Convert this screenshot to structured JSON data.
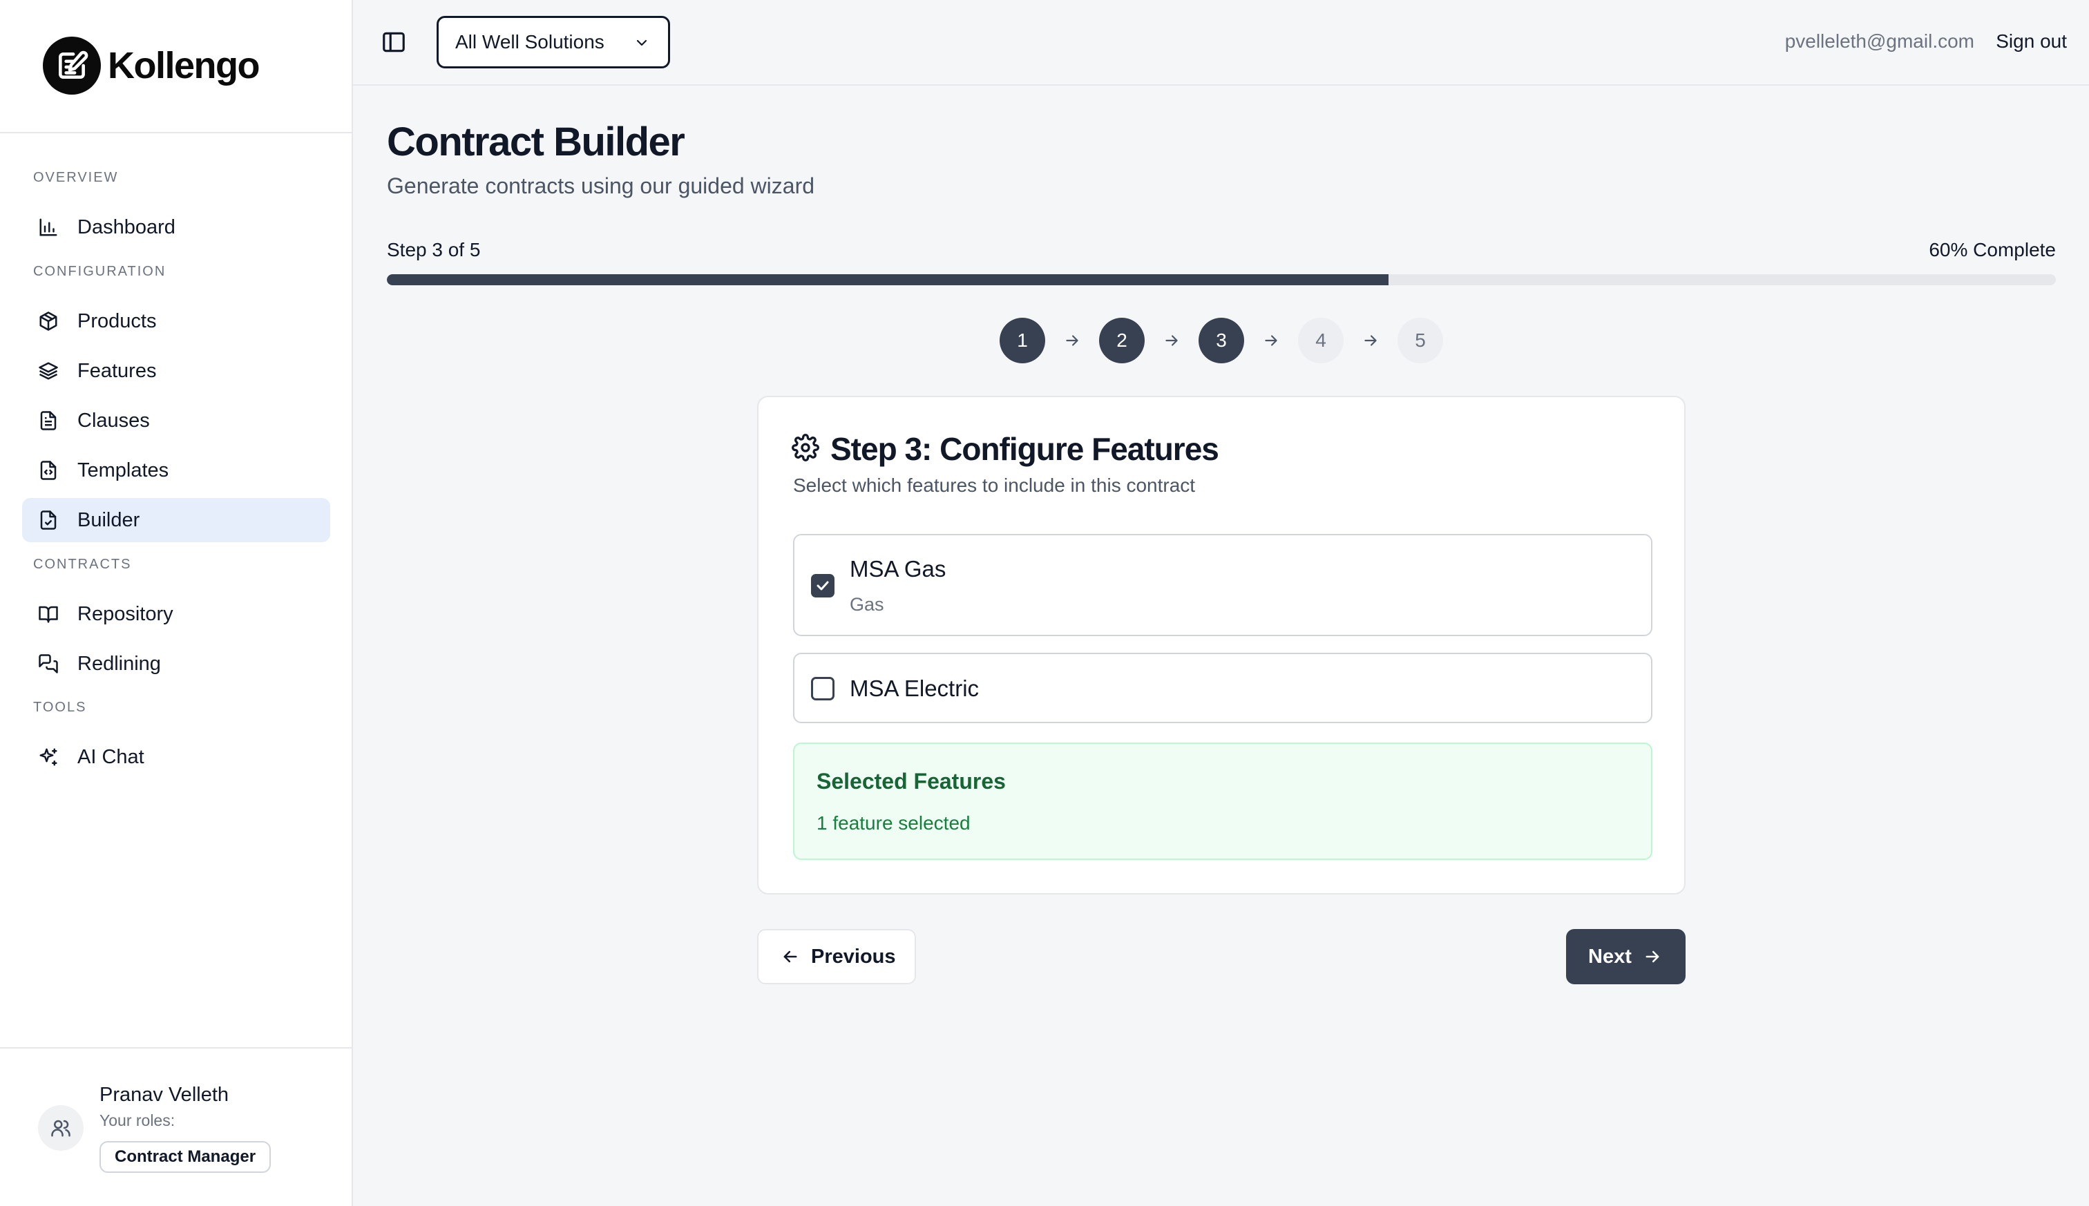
{
  "brand": {
    "name": "Kollengo",
    "icon": "pen-note-icon"
  },
  "sidebar": {
    "sections": [
      {
        "label": "OVERVIEW"
      },
      {
        "label": "CONFIGURATION"
      },
      {
        "label": "CONTRACTS"
      },
      {
        "label": "TOOLS"
      }
    ],
    "items": [
      {
        "label": "Dashboard",
        "icon": "bar-chart-icon"
      },
      {
        "label": "Products",
        "icon": "package-icon"
      },
      {
        "label": "Features",
        "icon": "layers-icon"
      },
      {
        "label": "Clauses",
        "icon": "document-icon"
      },
      {
        "label": "Templates",
        "icon": "file-code-icon"
      },
      {
        "label": "Builder",
        "icon": "file-check-icon",
        "active": true
      },
      {
        "label": "Repository",
        "icon": "book-open-icon"
      },
      {
        "label": "Redlining",
        "icon": "messages-icon"
      },
      {
        "label": "AI Chat",
        "icon": "sparkles-icon"
      }
    ],
    "user": {
      "name": "Pranav Velleth",
      "roles_label": "Your roles:",
      "role": "Contract Manager"
    }
  },
  "topbar": {
    "org_select": "All Well Solutions",
    "email": "pvelleleth@gmail.com",
    "sign_out": "Sign out"
  },
  "main": {
    "title": "Contract Builder",
    "subtitle": "Generate contracts using our guided wizard",
    "step_label": "Step 3 of 5",
    "progress_label": "60% Complete",
    "progress_fraction": 0.6,
    "steps": [
      {
        "label": "1",
        "state": "done"
      },
      {
        "label": "2",
        "state": "done"
      },
      {
        "label": "3",
        "state": "current"
      },
      {
        "label": "4",
        "state": "todo"
      },
      {
        "label": "5",
        "state": "todo"
      }
    ],
    "card": {
      "title": "Step 3: Configure Features",
      "description": "Select which features to include in this contract",
      "features": [
        {
          "name": "MSA Gas",
          "type": "Gas",
          "checked": true
        },
        {
          "name": "MSA Electric",
          "type": "",
          "checked": false
        }
      ],
      "selected": {
        "title": "Selected Features",
        "count": "1 feature selected"
      }
    },
    "buttons": {
      "previous": "Previous",
      "next": "Next"
    }
  },
  "colors": {
    "primary": "#374151",
    "active_nav_bg": "#e6eefb",
    "success_bg": "#f0fdf4",
    "success_text": "#166534"
  }
}
